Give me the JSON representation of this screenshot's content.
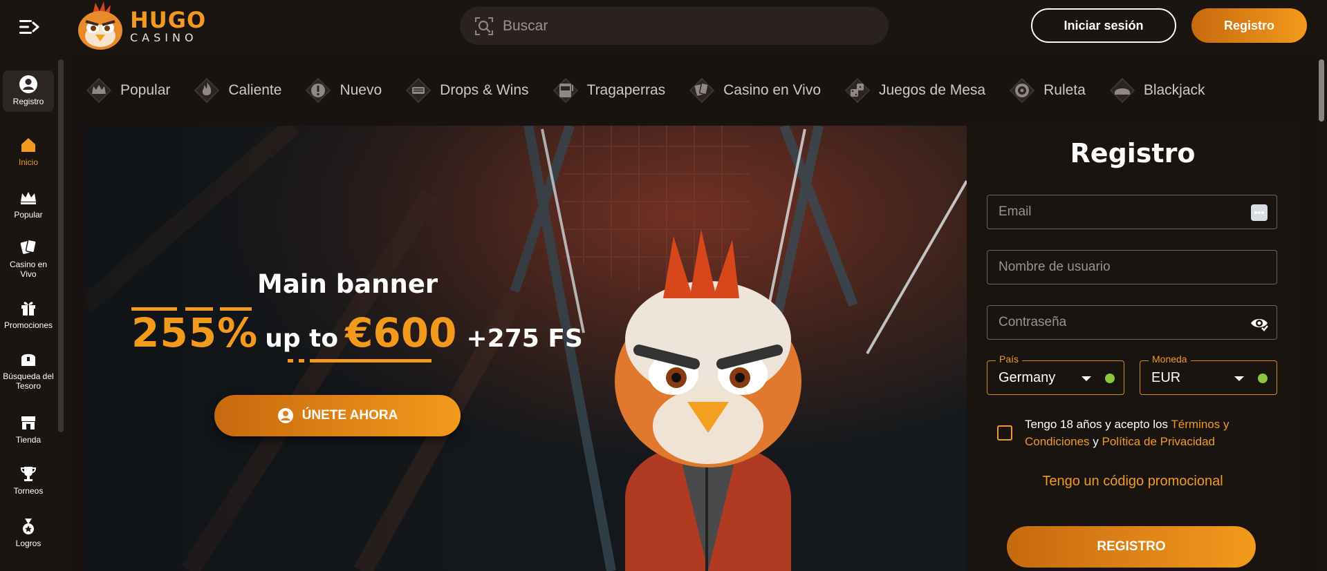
{
  "header": {
    "logo_title": "HUGO",
    "logo_subtitle": "CASINO",
    "search_placeholder": "Buscar",
    "login_label": "Iniciar sesión",
    "register_label": "Registro"
  },
  "sidebar": {
    "items": [
      {
        "label": "Registro",
        "icon": "user-icon"
      },
      {
        "label": "Inicio",
        "icon": "home-icon"
      },
      {
        "label": "Popular",
        "icon": "crown-icon"
      },
      {
        "label": "Casino en Vivo",
        "icon": "cards-icon"
      },
      {
        "label": "Promociones",
        "icon": "gift-icon"
      },
      {
        "label": "Búsqueda del Tesoro",
        "icon": "treasure-chest-icon"
      },
      {
        "label": "Tienda",
        "icon": "shop-icon"
      },
      {
        "label": "Torneos",
        "icon": "trophy-icon"
      },
      {
        "label": "Logros",
        "icon": "medal-icon"
      }
    ]
  },
  "categories": [
    {
      "label": "Popular",
      "icon": "crown-icon"
    },
    {
      "label": "Caliente",
      "icon": "fire-icon"
    },
    {
      "label": "Nuevo",
      "icon": "new-badge-icon"
    },
    {
      "label": "Drops & Wins",
      "icon": "drops-wins-icon"
    },
    {
      "label": "Tragaperras",
      "icon": "slot-machine-icon"
    },
    {
      "label": "Casino en Vivo",
      "icon": "cards-icon"
    },
    {
      "label": "Juegos de Mesa",
      "icon": "dice-icon"
    },
    {
      "label": "Ruleta",
      "icon": "roulette-icon"
    },
    {
      "label": "Blackjack",
      "icon": "blackjack-icon"
    }
  ],
  "banner": {
    "title": "Main banner",
    "percent": "255%",
    "up_to": "up to",
    "amount": "€600",
    "free_spins": "+275 FS",
    "join_label": "ÚNETE AHORA"
  },
  "registration": {
    "title": "Registro",
    "email_placeholder": "Email",
    "username_placeholder": "Nombre de usuario",
    "password_placeholder": "Contraseña",
    "country_legend": "País",
    "country_value": "Germany",
    "currency_legend": "Moneda",
    "currency_value": "EUR",
    "terms_text_1": "Tengo 18 años y acepto los ",
    "terms_link_1": "Términos y Condiciones",
    "terms_text_2": " y ",
    "terms_link_2": "Política de Privacidad",
    "promo_label": "Tengo un código promocional",
    "submit_label": "REGISTRO"
  },
  "colors": {
    "accent": "#f39a1c",
    "background": "#1a1411",
    "valid": "#8cc63f"
  }
}
